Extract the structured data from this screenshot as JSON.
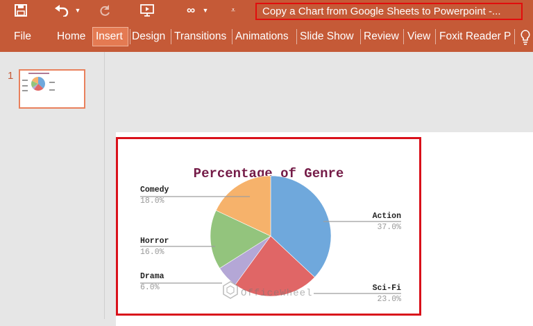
{
  "ribbon": {
    "title": "Copy a Chart from Google Sheets to Powerpoint -...",
    "tabs": [
      "File",
      "Home",
      "Insert",
      "Design",
      "Transitions",
      "Animations",
      "Slide Show",
      "Review",
      "View",
      "Foxit Reader P"
    ],
    "active_tab": "Insert",
    "icons": [
      "save-icon",
      "undo-icon",
      "redo-icon",
      "from-beginning-icon",
      "more-icon",
      "customize-icon",
      "tell-me-icon"
    ]
  },
  "slides_pane": {
    "slide_number": "1"
  },
  "watermark": "OfficeWheel",
  "colors": {
    "ribbon": "#c55a37",
    "highlight": "#d9101a"
  },
  "chart_data": {
    "type": "pie",
    "title": "Percentage of Genre",
    "categories": [
      "Action",
      "Sci-Fi",
      "Drama",
      "Horror",
      "Comedy"
    ],
    "values": [
      37.0,
      23.0,
      6.0,
      16.0,
      18.0
    ],
    "labels": [
      "37.0%",
      "23.0%",
      "6.0%",
      "16.0%",
      "18.0%"
    ],
    "colors": [
      "#6fa8dc",
      "#e06666",
      "#b4a7d6",
      "#93c47d",
      "#f6b26b"
    ]
  }
}
